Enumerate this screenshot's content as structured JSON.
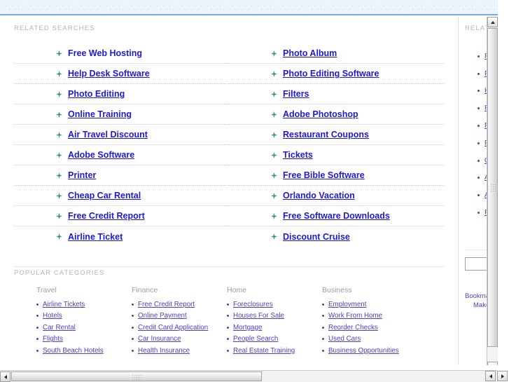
{
  "related_searches": {
    "heading": "RELATED SEARCHES",
    "left_column": [
      {
        "label": "Free Web Hosting",
        "underlined": false
      },
      {
        "label": "Help Desk Software",
        "underlined": true
      },
      {
        "label": "Photo Editing",
        "underlined": true
      },
      {
        "label": "Online Training",
        "underlined": true
      },
      {
        "label": "Air Travel Discount",
        "underlined": true
      },
      {
        "label": "Adobe Software",
        "underlined": true
      },
      {
        "label": "Printer",
        "underlined": true
      },
      {
        "label": "Cheap Car Rental",
        "underlined": true
      },
      {
        "label": "Free Credit Report",
        "underlined": true
      },
      {
        "label": "Airline Ticket",
        "underlined": true
      }
    ],
    "right_column": [
      {
        "label": "Photo Album",
        "underlined": true
      },
      {
        "label": "Photo Editing Software",
        "underlined": true
      },
      {
        "label": "Filters",
        "underlined": true
      },
      {
        "label": "Adobe Photoshop",
        "underlined": true
      },
      {
        "label": "Restaurant Coupons",
        "underlined": true
      },
      {
        "label": "Tickets",
        "underlined": true
      },
      {
        "label": "Free Bible Software",
        "underlined": true
      },
      {
        "label": "Orlando Vacation",
        "underlined": true
      },
      {
        "label": "Free Software Downloads",
        "underlined": true
      },
      {
        "label": "Discount Cruise",
        "underlined": true
      }
    ]
  },
  "popular_categories": {
    "heading": "POPULAR CATEGORIES",
    "columns": [
      {
        "title": "Travel",
        "items": [
          "Airline Tickets",
          "Hotels",
          "Car Rental",
          "Flights",
          "South Beach Hotels"
        ]
      },
      {
        "title": "Finance",
        "items": [
          "Free Credit Report",
          "Online Payment",
          "Credit Card Application",
          "Car Insurance",
          "Health Insurance"
        ]
      },
      {
        "title": "Home",
        "items": [
          "Foreclosures",
          "Houses For Sale",
          "Mortgage",
          "People Search",
          "Real Estate Training"
        ]
      },
      {
        "title": "Business",
        "items": [
          "Employment",
          "Work From Home",
          "Reorder Checks",
          "Used Cars",
          "Business Opportunities"
        ]
      }
    ]
  },
  "sidebar": {
    "heading": "RELATED",
    "items": [
      "Free Web Hosting",
      "Photo Album",
      "Help Desk Software",
      "Photo Editing Software",
      "Photo Editing",
      "Filters",
      "Online Training",
      "Adobe Photoshop",
      "Air Travel Discount",
      "Restaurant Coupons"
    ],
    "search_value": "",
    "search_placeholder": "",
    "footer_links": [
      "Bookmark",
      "Make this"
    ]
  },
  "colors": {
    "link_blue": "#1f18d6",
    "secondary_link": "#4b43c9",
    "heading_gray": "#b0b4bb",
    "band_blue": "#eef4fb",
    "band_border": "#7aa7d4",
    "bullet_green": "#2f9e5f"
  }
}
